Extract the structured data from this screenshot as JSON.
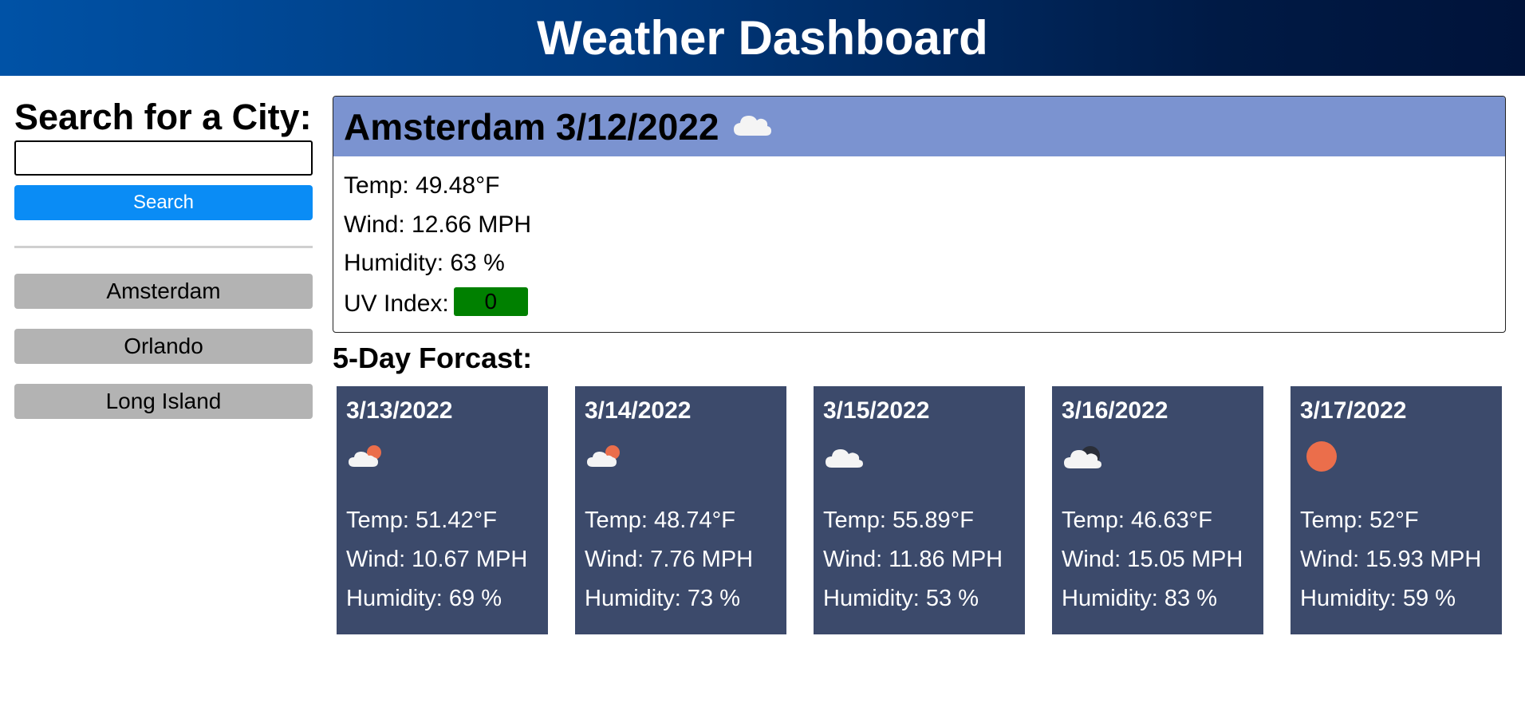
{
  "header": {
    "title": "Weather Dashboard"
  },
  "sidebar": {
    "heading": "Search for a City:",
    "search_value": "",
    "search_button": "Search",
    "history": [
      "Amsterdam",
      "Orlando",
      "Long Island"
    ]
  },
  "current": {
    "title": "Amsterdam 3/12/2022",
    "icon": "cloud-icon",
    "temp": "Temp: 49.48°F",
    "wind": "Wind: 12.66 MPH",
    "humidity": "Humidity: 63 %",
    "uv_label": "UV Index:",
    "uv_value": "0",
    "uv_color": "#008000"
  },
  "forecast": {
    "title": "5-Day Forcast:",
    "days": [
      {
        "date": "3/13/2022",
        "icon": "partly-cloudy-icon",
        "temp": "Temp: 51.42°F",
        "wind": "Wind: 10.67 MPH",
        "humidity": "Humidity: 69 %"
      },
      {
        "date": "3/14/2022",
        "icon": "partly-cloudy-icon",
        "temp": "Temp: 48.74°F",
        "wind": "Wind: 7.76 MPH",
        "humidity": "Humidity: 73 %"
      },
      {
        "date": "3/15/2022",
        "icon": "cloud-icon",
        "temp": "Temp: 55.89°F",
        "wind": "Wind: 11.86 MPH",
        "humidity": "Humidity: 53 %"
      },
      {
        "date": "3/16/2022",
        "icon": "cloudy-night-icon",
        "temp": "Temp: 46.63°F",
        "wind": "Wind: 15.05 MPH",
        "humidity": "Humidity: 83 %"
      },
      {
        "date": "3/17/2022",
        "icon": "sun-icon",
        "temp": "Temp: 52°F",
        "wind": "Wind: 15.93 MPH",
        "humidity": "Humidity: 59 %"
      }
    ]
  },
  "colors": {
    "accent_blue": "#0a8cf5",
    "card_bg": "#3c4a6b",
    "current_header_bg": "#7b93d0",
    "history_bg": "#b3b3b3",
    "sun": "#eb6e4b"
  }
}
